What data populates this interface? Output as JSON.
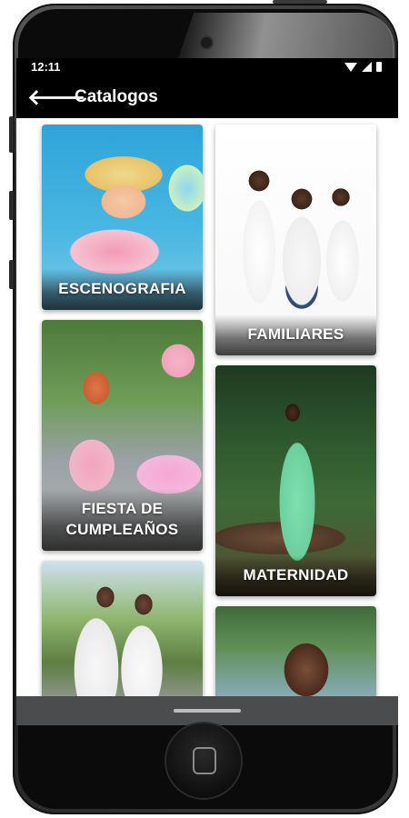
{
  "status_bar": {
    "time": "12:11",
    "icons": [
      "wifi-icon",
      "signal-icon",
      "battery-icon"
    ]
  },
  "app_bar": {
    "back_icon": "back-arrow-icon",
    "back_glyph": "🡐",
    "title": "Catalogos"
  },
  "catalog": {
    "items": [
      {
        "label": "ESCENOGRAFIA"
      },
      {
        "label": "FAMILIARES"
      },
      {
        "label": "FIESTA DE CUMPLEAÑOS"
      },
      {
        "label": "MATERNIDAD"
      },
      {
        "label": ""
      },
      {
        "label": ""
      }
    ]
  },
  "colors": {
    "app_bar_bg": "#000000",
    "nav_bar_bg": "#4a4c4e",
    "label_text": "#ffffff"
  }
}
